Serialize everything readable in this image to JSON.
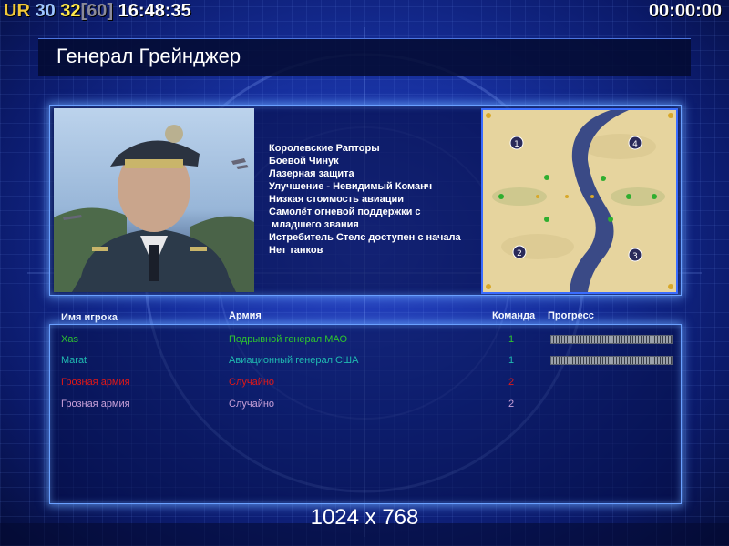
{
  "hud": {
    "ur_label": "UR",
    "ur_value": "30",
    "fps_value": "32",
    "fps_bracket_open": "[",
    "fps_cap": "60",
    "fps_bracket_close": "]",
    "clock": "16:48:35",
    "game_timer": "00:00:00"
  },
  "general": {
    "title": "Генерал Грейнджер",
    "features": [
      "Королевские Рапторы",
      "Боевой Чинук",
      "Лазерная защита",
      "Улучшение - Невидимый Команч",
      "Низкая стоимость авиации",
      "Самолёт огневой поддержки с",
      " младшего звания",
      "Истребитель Стелс доступен с начала",
      "Нет танков"
    ]
  },
  "minimap": {
    "start_positions": [
      "1",
      "2",
      "3",
      "4"
    ]
  },
  "players_table": {
    "headers": {
      "name": "Имя игрока",
      "army": "Армия",
      "team": "Команда",
      "progress": "Прогресс"
    },
    "rows": [
      {
        "name": "Xas",
        "army": "Подрывной генерал МАО",
        "team": "1",
        "progress": 1.0,
        "color": "#2ec42e"
      },
      {
        "name": "Marat",
        "army": "Авиационный генерал США",
        "team": "1",
        "progress": 1.0,
        "color": "#20b8b0"
      },
      {
        "name": "Грозная армия",
        "army": "Случайно",
        "team": "2",
        "progress": null,
        "color": "#e01818"
      },
      {
        "name": "Грозная армия",
        "army": "Случайно",
        "team": "2",
        "progress": null,
        "color": "#c8a0d8"
      }
    ]
  },
  "resolution_label": "1024 x 768"
}
